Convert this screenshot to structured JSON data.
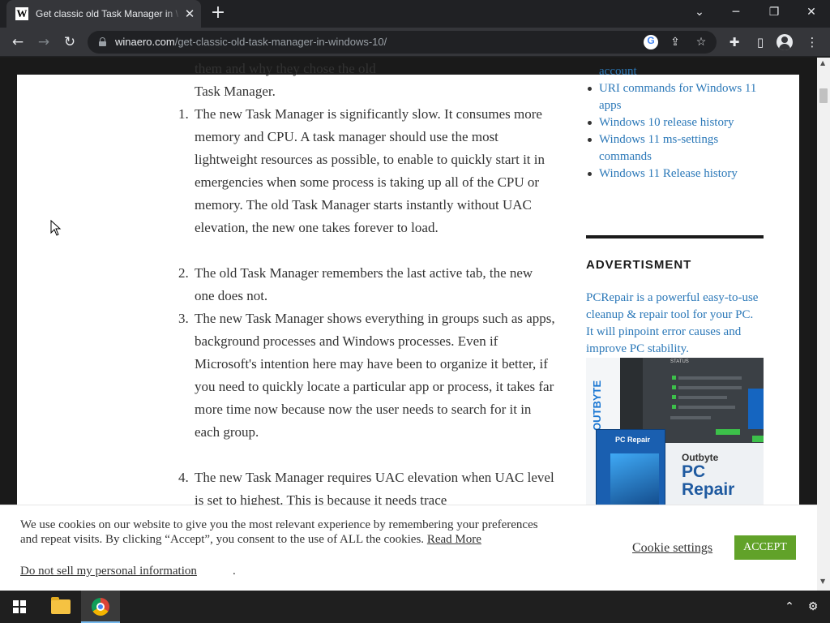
{
  "browser": {
    "tab": {
      "favicon": "W",
      "title": "Get classic old Task Manager in W",
      "close": "✕"
    },
    "new_tab": "+",
    "window_controls": {
      "tab_search": "⌄",
      "minimize": "─",
      "restore": "❐",
      "close": "✕"
    },
    "toolbar": {
      "back": "←",
      "forward": "→",
      "reload": "↻",
      "url_domain": "winaero.com",
      "url_path": "/get-classic-old-task-manager-in-windows-10/",
      "google_icon": "G",
      "share_icon": "⇪",
      "bookmark_icon": "☆",
      "extensions_icon": "✚",
      "sidepanel_icon": "▯",
      "menu_icon": "⋮"
    }
  },
  "article": {
    "intro_cut": "them and why they chose the old",
    "intro_tail": "Task Manager.",
    "items": [
      {
        "num": "1.",
        "text": "The new Task Manager is significantly slow. It consumes more memory and CPU. A task manager should use the most lightweight resources as possible, to enable to quickly start it in emergencies when some process is taking up all of the CPU or memory. The old Task Manager starts instantly without UAC elevation, the new one takes forever to load."
      },
      {
        "num": "2.",
        "text": "The old Task Manager remembers the last active tab, the new one does not."
      },
      {
        "num": "3.",
        "text": "The new Task Manager shows everything in groups such as apps, background processes and Windows processes. Even if Microsoft's intention here may have been to organize it better, if you need to quickly locate a particular app or process, it takes far more time now because now the user needs to search for it in each group."
      },
      {
        "num": "4.",
        "text": "The new Task Manager requires UAC elevation when UAC level is set to highest. This is because it needs trace"
      }
    ]
  },
  "sidebar": {
    "links": [
      "account",
      "URI commands for Windows 11 apps",
      "Windows 10 release history",
      "Windows 11 ms-settings commands",
      "Windows 11 Release history"
    ],
    "ad_heading": "ADVERTISMENT",
    "ad_text": "PCRepair is a powerful easy-to-use cleanup & repair tool for your PC. It will pinpoint error causes and improve PC stability.",
    "ad_image": {
      "brand_vertical": "OUTBYTE",
      "status": "STATUS",
      "box_label": "PC Repair",
      "brand": "Outbyte",
      "product": "PC Repair"
    }
  },
  "cookie": {
    "text": "We use cookies on our website to give you the most relevant experience by remembering your preferences and repeat visits. By clicking “Accept”, you consent to the use of ALL the cookies.",
    "read_more": "Read More",
    "do_not_sell": "Do not sell my personal information",
    "do_not_sell_end": ".",
    "settings": "Cookie settings",
    "accept": "ACCEPT"
  },
  "scrollbar": {
    "up": "▲",
    "down": "▼"
  },
  "taskbar": {
    "tray_chevron": "⌃",
    "settings_icon": "⚙"
  }
}
